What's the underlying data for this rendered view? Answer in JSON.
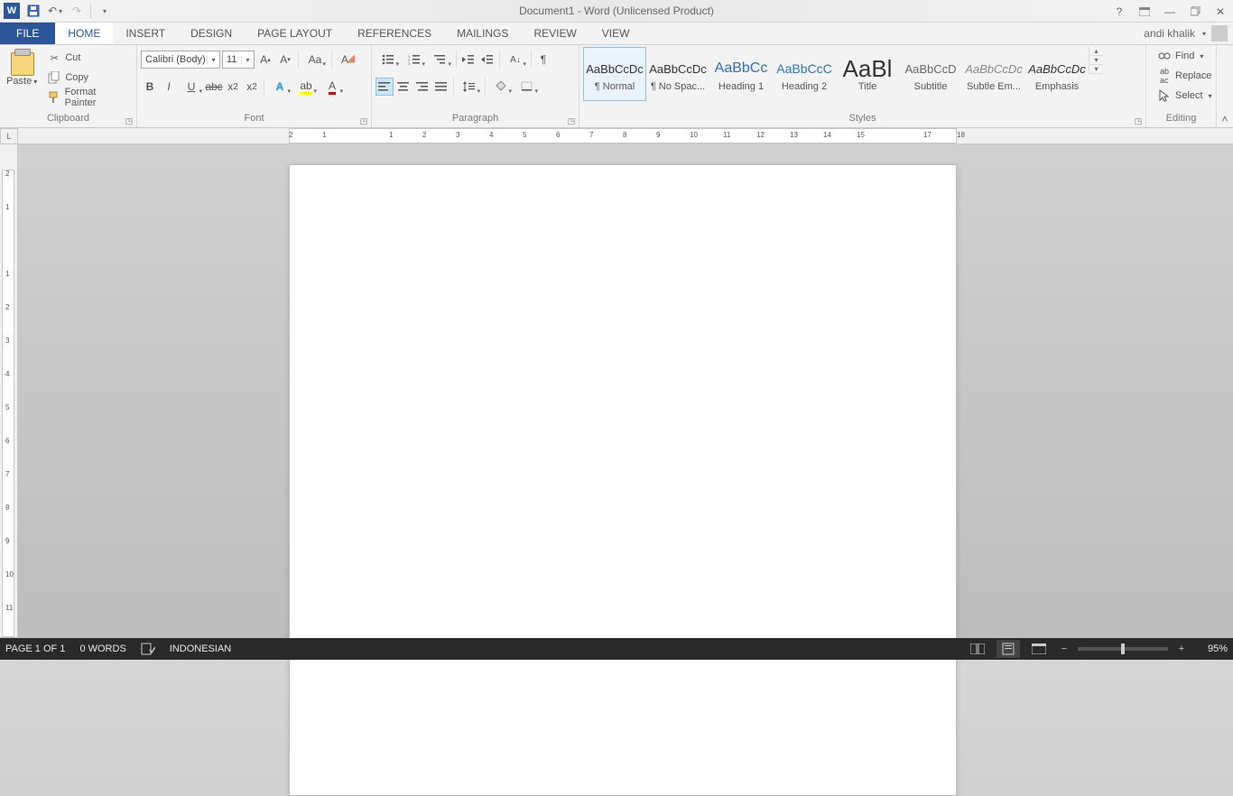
{
  "title": "Document1 - Word (Unlicensed Product)",
  "user": "andi khalik",
  "tabs": {
    "file": "FILE",
    "home": "HOME",
    "insert": "INSERT",
    "design": "DESIGN",
    "page_layout": "PAGE LAYOUT",
    "references": "REFERENCES",
    "mailings": "MAILINGS",
    "review": "REVIEW",
    "view": "VIEW"
  },
  "clipboard": {
    "paste": "Paste",
    "cut": "Cut",
    "copy": "Copy",
    "format_painter": "Format Painter",
    "label": "Clipboard"
  },
  "font": {
    "name": "Calibri (Body)",
    "size": "11",
    "label": "Font"
  },
  "paragraph": {
    "label": "Paragraph"
  },
  "styles_label": "Styles",
  "styles": [
    {
      "preview": "AaBbCcDc",
      "name": "¶ Normal",
      "css": "font-size:13px;"
    },
    {
      "preview": "AaBbCcDc",
      "name": "¶ No Spac...",
      "css": "font-size:13px;"
    },
    {
      "preview": "AaBbCc",
      "name": "Heading 1",
      "css": "font-size:16px;color:#2e74b5;"
    },
    {
      "preview": "AaBbCcC",
      "name": "Heading 2",
      "css": "font-size:14px;color:#2e74b5;"
    },
    {
      "preview": "AaBl",
      "name": "Title",
      "css": "font-size:26px;"
    },
    {
      "preview": "AaBbCcD",
      "name": "Subtitle",
      "css": "font-size:13px;color:#666;"
    },
    {
      "preview": "AaBbCcDc",
      "name": "Subtle Em...",
      "css": "font-size:13px;font-style:italic;color:#888;"
    },
    {
      "preview": "AaBbCcDc",
      "name": "Emphasis",
      "css": "font-size:13px;font-style:italic;"
    }
  ],
  "editing": {
    "find": "Find",
    "replace": "Replace",
    "select": "Select",
    "label": "Editing"
  },
  "status": {
    "page": "PAGE 1 OF 1",
    "words": "0 WORDS",
    "lang": "INDONESIAN",
    "zoom": "95%"
  },
  "ruler_h": [
    "2",
    "1",
    "",
    "1",
    "2",
    "3",
    "4",
    "5",
    "6",
    "7",
    "8",
    "9",
    "10",
    "11",
    "12",
    "13",
    "14",
    "15",
    "",
    "17",
    "18"
  ],
  "ruler_v": [
    "2",
    "1",
    "",
    "1",
    "2",
    "3",
    "4",
    "5",
    "6",
    "7",
    "8",
    "9",
    "10",
    "11"
  ]
}
